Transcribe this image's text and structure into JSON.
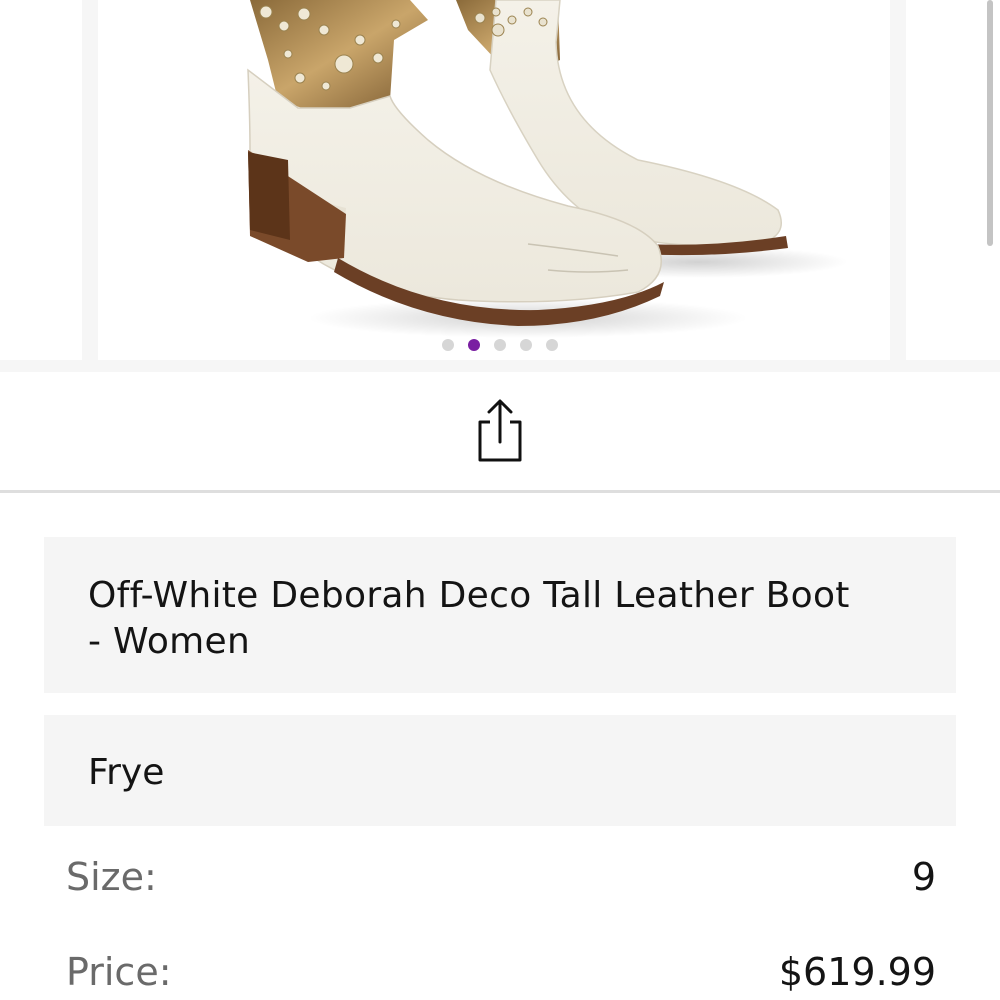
{
  "carousel": {
    "slide_count": 5,
    "active_index": 1,
    "image_alt": "boot-product-photo"
  },
  "share": {
    "icon": "share-icon"
  },
  "product": {
    "title_line1": "Off-White Deborah Deco Tall Leather Boot",
    "title_line2": "- Women",
    "brand": "Frye"
  },
  "details": {
    "size_label": "Size:",
    "size_value": "9",
    "price_label": "Price:",
    "price_value": "$619.99"
  },
  "colors": {
    "active_dot": "#7a1fa2",
    "inactive_dot": "#d6d6d6",
    "card_bg": "#f5f5f5"
  }
}
